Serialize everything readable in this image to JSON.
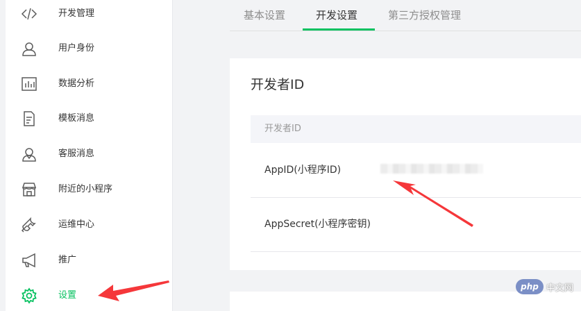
{
  "sidebar": {
    "items": [
      {
        "label": "开发管理",
        "icon": "code-icon"
      },
      {
        "label": "用户身份",
        "icon": "user-icon"
      },
      {
        "label": "数据分析",
        "icon": "bar-chart-icon"
      },
      {
        "label": "模板消息",
        "icon": "document-icon"
      },
      {
        "label": "客服消息",
        "icon": "customer-service-icon"
      },
      {
        "label": "附近的小程序",
        "icon": "store-icon"
      },
      {
        "label": "运维中心",
        "icon": "wrench-icon"
      },
      {
        "label": "推广",
        "icon": "megaphone-icon"
      },
      {
        "label": "设置",
        "icon": "gear-icon",
        "active": true
      }
    ]
  },
  "tabs": [
    {
      "label": "基本设置"
    },
    {
      "label": "开发设置",
      "active": true
    },
    {
      "label": "第三方授权管理"
    }
  ],
  "card": {
    "title": "开发者ID",
    "table_header": "开发者ID",
    "rows": [
      {
        "label": "AppID(小程序ID)",
        "value_hidden": true
      },
      {
        "label": "AppSecret(小程序密钥)"
      }
    ]
  },
  "watermark": {
    "logo": "php",
    "text": "中文网"
  },
  "colors": {
    "accent": "#07c160",
    "arrow": "#f5373a"
  }
}
